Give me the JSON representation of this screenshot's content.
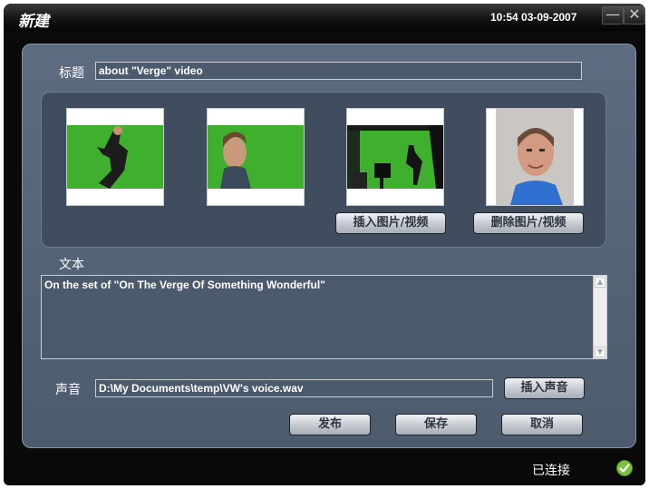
{
  "window": {
    "title": "新建",
    "clock": "10:54 03-09-2007",
    "minimize_glyph": "—",
    "close_glyph": "✕"
  },
  "form": {
    "title_label": "标题",
    "title_value": "about \"Verge\" video",
    "text_label": "文本",
    "text_value": "On the set of \"On The Verge Of Something Wonderful\"",
    "sound_label": "声音",
    "sound_value": "D:\\My Documents\\temp\\VW's voice.wav"
  },
  "media": {
    "insert_label": "插入图片/视频",
    "delete_label": "删除图片/视频",
    "thumbnails": [
      {
        "subject": "man-dancing-green-screen"
      },
      {
        "subject": "man-profile-green-screen"
      },
      {
        "subject": "studio-green-screen-wide"
      },
      {
        "subject": "man-portrait-blue-shirt"
      }
    ]
  },
  "buttons": {
    "insert_sound": "插入声音",
    "publish": "发布",
    "save": "保存",
    "cancel": "取消"
  },
  "status": {
    "text": "已连接",
    "icon": "check-circle-icon",
    "icon_color": "#7cc241"
  },
  "colors": {
    "panel": "#55647a",
    "green_screen": "#3fb02e",
    "titlebar": "#1a1a1a"
  }
}
